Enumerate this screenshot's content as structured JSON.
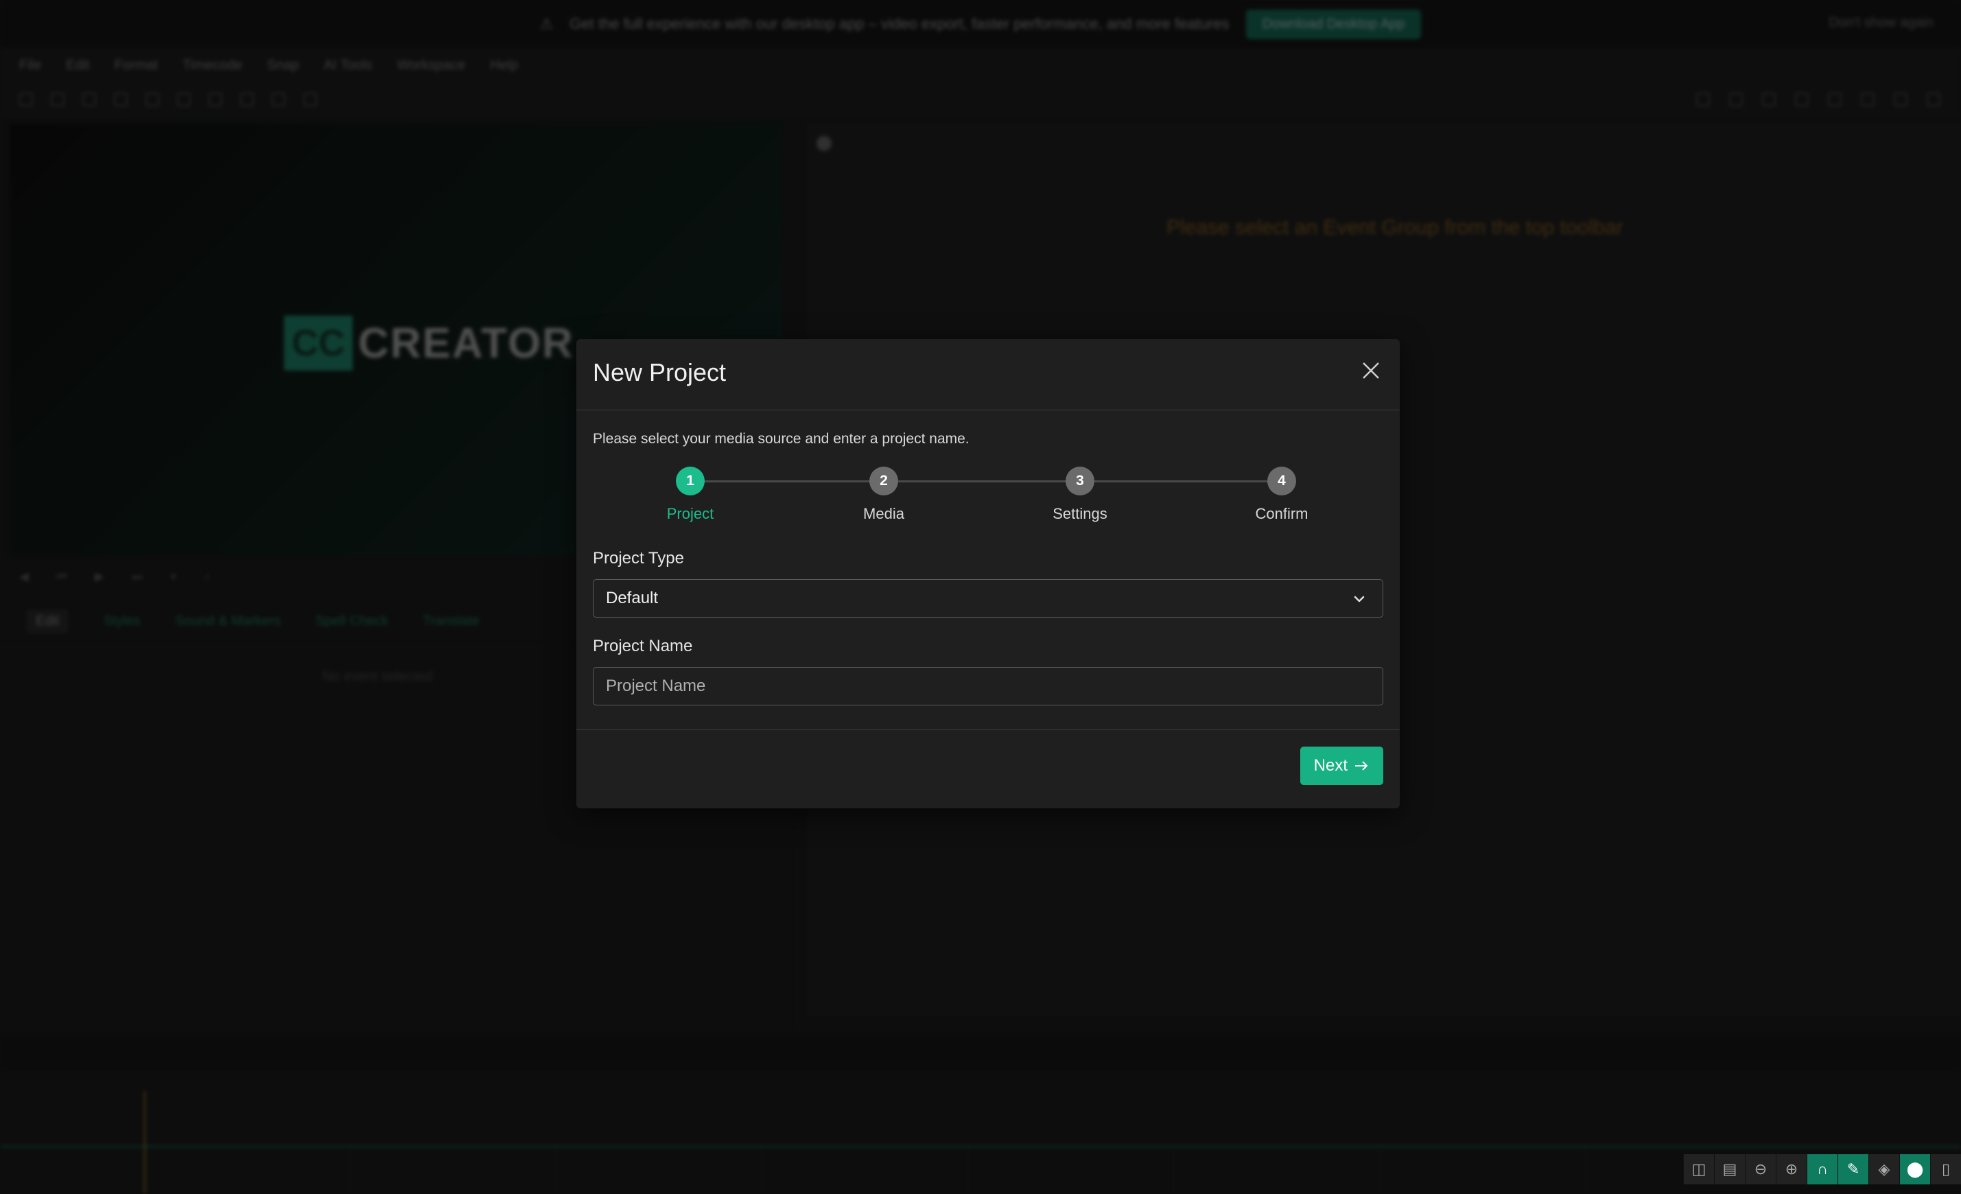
{
  "banner": {
    "message": "Get the full experience with our desktop app – video export, faster performance, and more features",
    "button_label": "Download Desktop App",
    "right_text": "Don't show again"
  },
  "menu": [
    "File",
    "Edit",
    "Format",
    "Timecode",
    "Snap",
    "AI Tools",
    "Workspace",
    "Help"
  ],
  "preview": {
    "logo_box": "CC",
    "logo_word": "CREATOR"
  },
  "left_tabs": [
    "Edit",
    "Styles",
    "Sound & Markers",
    "Spell Check",
    "Translate"
  ],
  "left_empty": "No event selected",
  "right_panel": {
    "message": "Please select an Event Group from the top toolbar"
  },
  "modal": {
    "title": "New Project",
    "instructions": "Please select your media source and enter a project name.",
    "steps": [
      {
        "number": "1",
        "label": "Project"
      },
      {
        "number": "2",
        "label": "Media"
      },
      {
        "number": "3",
        "label": "Settings"
      },
      {
        "number": "4",
        "label": "Confirm"
      }
    ],
    "active_step": 1,
    "project_type_label": "Project Type",
    "project_type_value": "Default",
    "project_name_label": "Project Name",
    "project_name_value": "",
    "project_name_placeholder": "Project Name",
    "next_label": "Next"
  },
  "colors": {
    "accent": "#1dbc8d",
    "warning_text": "#a06a1a",
    "playhead": "#caa219"
  },
  "timeline_tools": [
    "split-icon",
    "caption-icon",
    "zoom-out-icon",
    "zoom-in-icon",
    "magnet-icon",
    "pencil-icon",
    "layers-icon",
    "marker-icon",
    "more-icon"
  ]
}
